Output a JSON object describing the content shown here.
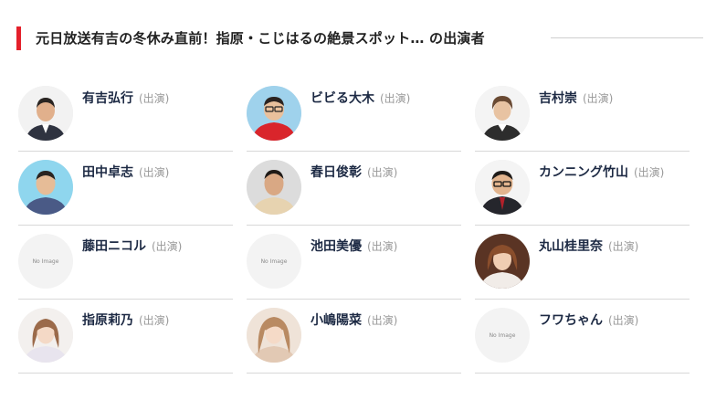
{
  "header": {
    "title": "元日放送有吉の冬休み直前！指原・こじはるの絶景スポット… の出演者",
    "accent_color": "#e4202b"
  },
  "cast": [
    {
      "name": "有吉弘行",
      "role": "(出演)",
      "has_image": true
    },
    {
      "name": "ビビる大木",
      "role": "(出演)",
      "has_image": true
    },
    {
      "name": "吉村崇",
      "role": "(出演)",
      "has_image": true
    },
    {
      "name": "田中卓志",
      "role": "(出演)",
      "has_image": true
    },
    {
      "name": "春日俊彰",
      "role": "(出演)",
      "has_image": true
    },
    {
      "name": "カンニング竹山",
      "role": "(出演)",
      "has_image": true
    },
    {
      "name": "藤田ニコル",
      "role": "(出演)",
      "has_image": false,
      "placeholder": "No Image"
    },
    {
      "name": "池田美優",
      "role": "(出演)",
      "has_image": false,
      "placeholder": "No Image"
    },
    {
      "name": "丸山桂里奈",
      "role": "(出演)",
      "has_image": true
    },
    {
      "name": "指原莉乃",
      "role": "(出演)",
      "has_image": true
    },
    {
      "name": "小嶋陽菜",
      "role": "(出演)",
      "has_image": true
    },
    {
      "name": "フワちゃん",
      "role": "(出演)",
      "has_image": false,
      "placeholder": "No Image"
    }
  ]
}
